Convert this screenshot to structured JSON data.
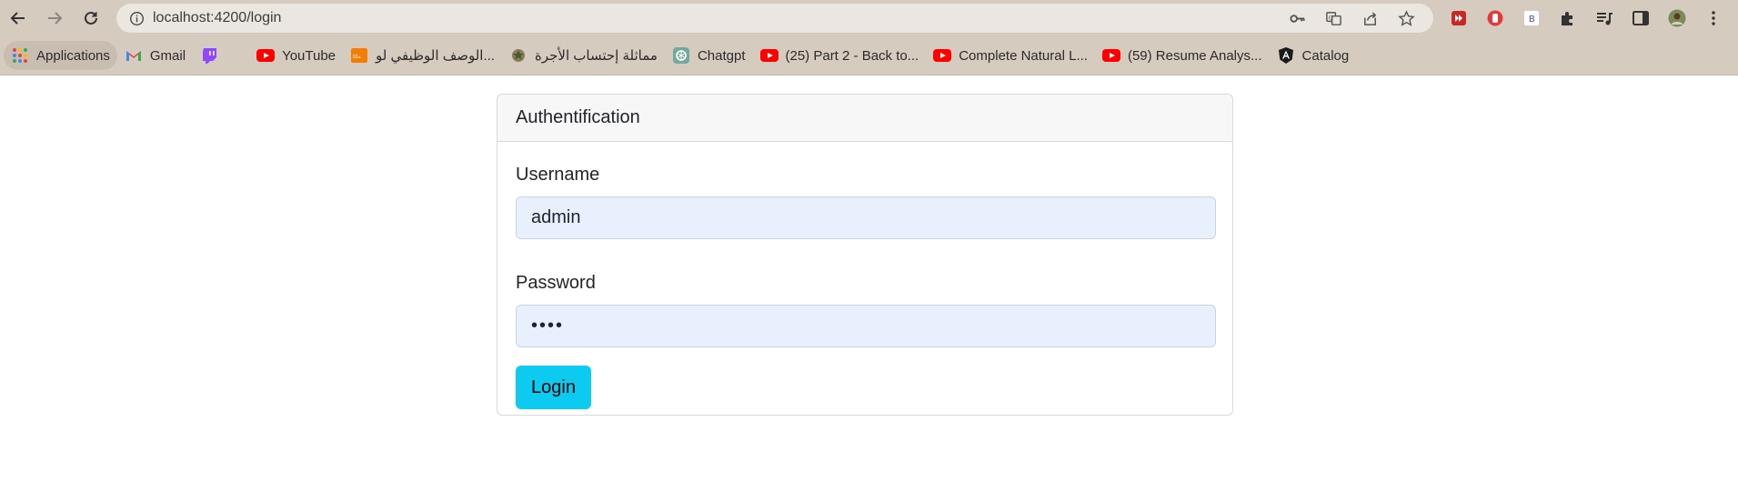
{
  "browser": {
    "url": "localhost:4200/login",
    "bookmarks": [
      {
        "label": "Applications",
        "icon": "apps-grid-icon"
      },
      {
        "label": "Gmail",
        "icon": "gmail-icon"
      },
      {
        "label": "",
        "icon": "twitch-icon"
      },
      {
        "label": "YouTube",
        "icon": "youtube-icon"
      },
      {
        "label": "الوصف الوظيفي لو...",
        "icon": "site-logo-icon"
      },
      {
        "label": "مماثلة إحتساب الأجرة",
        "icon": "emblem-icon"
      },
      {
        "label": "Chatgpt",
        "icon": "chatgpt-icon"
      },
      {
        "label": "(25) Part 2 - Back to...",
        "icon": "youtube-icon"
      },
      {
        "label": "Complete Natural L...",
        "icon": "youtube-icon"
      },
      {
        "label": "(59) Resume Analys...",
        "icon": "youtube-icon"
      },
      {
        "label": "Catalog",
        "icon": "angular-icon"
      }
    ]
  },
  "login": {
    "header": "Authentification",
    "username_label": "Username",
    "username_value": "admin",
    "password_label": "Password",
    "password_value": "••••",
    "submit_label": "Login"
  },
  "colors": {
    "chrome": "#d6cbbf",
    "input_bg": "#e8f0fe",
    "button": "#0dcaf0"
  }
}
